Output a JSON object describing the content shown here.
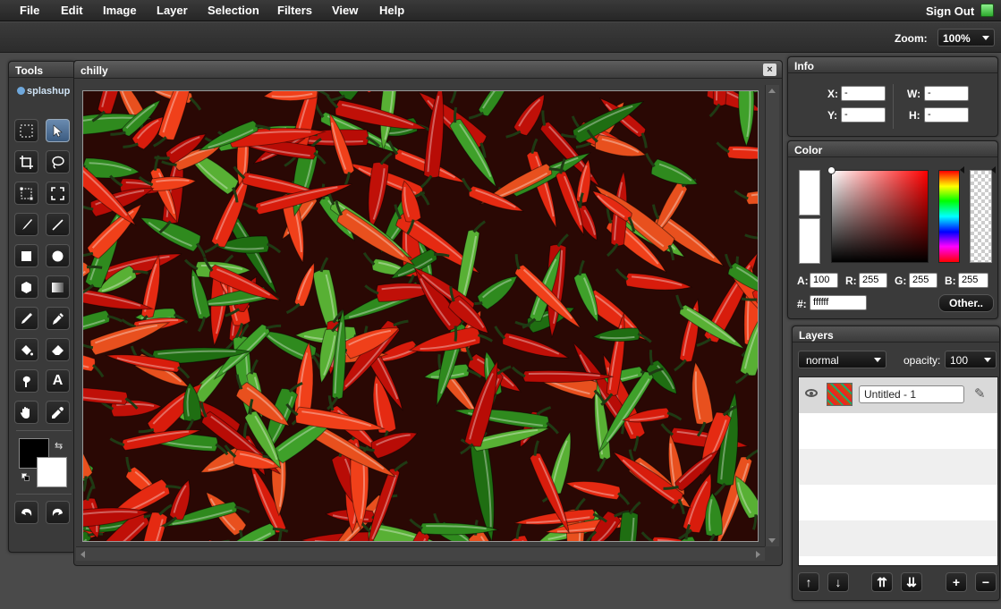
{
  "menu": {
    "items": [
      "File",
      "Edit",
      "Image",
      "Layer",
      "Selection",
      "Filters",
      "View",
      "Help"
    ],
    "sign_out": "Sign Out"
  },
  "toolbar": {
    "zoom_label": "Zoom:",
    "zoom_value": "100%"
  },
  "tools_panel": {
    "title": "Tools",
    "logo": "splashup",
    "tools": [
      "marquee",
      "pointer",
      "crop",
      "lasso",
      "transform",
      "selection-transform",
      "brush",
      "line",
      "rectangle",
      "ellipse",
      "polygon",
      "gradient",
      "pencil",
      "eyedropper-pen",
      "fill-bucket",
      "eraser",
      "smudge",
      "text",
      "hand",
      "color-picker"
    ],
    "text_tool_glyph": "A",
    "foreground_color": "#000000",
    "background_color": "#ffffff"
  },
  "document": {
    "title": "chilly",
    "close_label": "×"
  },
  "info": {
    "title": "Info",
    "x_label": "X:",
    "x_value": "-",
    "y_label": "Y:",
    "y_value": "-",
    "w_label": "W:",
    "w_value": "-",
    "h_label": "H:",
    "h_value": "-"
  },
  "color": {
    "title": "Color",
    "a_label": "A:",
    "a_value": "100",
    "r_label": "R:",
    "r_value": "255",
    "g_label": "G:",
    "g_value": "255",
    "b_label": "B:",
    "b_value": "255",
    "hex_label": "#:",
    "hex_value": "ffffff",
    "other_button": "Other.."
  },
  "layers": {
    "title": "Layers",
    "blend_mode": "normal",
    "opacity_label": "opacity:",
    "opacity_value": "100",
    "items": [
      {
        "name": "Untitled - 1",
        "visible": true
      }
    ]
  }
}
